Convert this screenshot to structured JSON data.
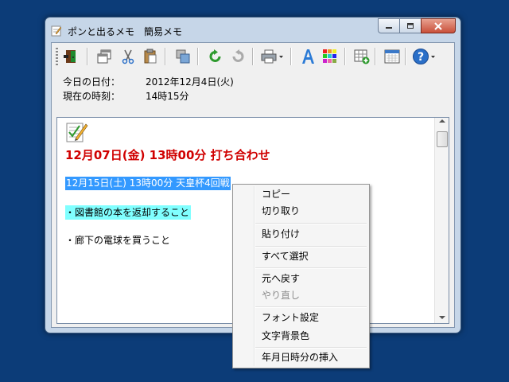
{
  "window": {
    "title": "ポンと出るメモ　簡易メモ"
  },
  "toolbar": {
    "buttons": [
      {
        "icon": "exit-door-icon"
      },
      {
        "icon": "window-restore-icon"
      },
      {
        "icon": "cut-icon"
      },
      {
        "icon": "paste-icon"
      },
      {
        "icon": "copy-window-icon"
      },
      {
        "icon": "undo-icon"
      },
      {
        "icon": "redo-icon"
      },
      {
        "icon": "print-dropdown-icon"
      },
      {
        "icon": "font-icon"
      },
      {
        "icon": "color-palette-icon"
      },
      {
        "icon": "insert-date-icon"
      },
      {
        "icon": "calendar-icon"
      },
      {
        "icon": "help-dropdown-icon"
      }
    ]
  },
  "info": {
    "date_label": "今日の日付：",
    "date_value": "2012年12月4日(火)",
    "time_label": "現在の時刻：",
    "time_value": "14時15分"
  },
  "memo": {
    "line1": "12月07日(金) 13時00分 打ち合わせ",
    "line2": "12月15日(土) 13時00分 天皇杯4回戦",
    "line3": "・図書館の本を返却すること",
    "line4": "・廊下の電球を買うこと"
  },
  "context_menu": {
    "copy": "コピー",
    "cut": "切り取り",
    "paste": "貼り付け",
    "select_all": "すべて選択",
    "undo": "元へ戻す",
    "redo": "やり直し",
    "font": "フォント設定",
    "bg_color": "文字背景色",
    "insert_datetime": "年月日時分の挿入"
  },
  "colors": {
    "desktop": "#0c3c78",
    "heading_red": "#d00000",
    "selection_blue": "#3399ff",
    "highlight_cyan": "#80ffff"
  }
}
